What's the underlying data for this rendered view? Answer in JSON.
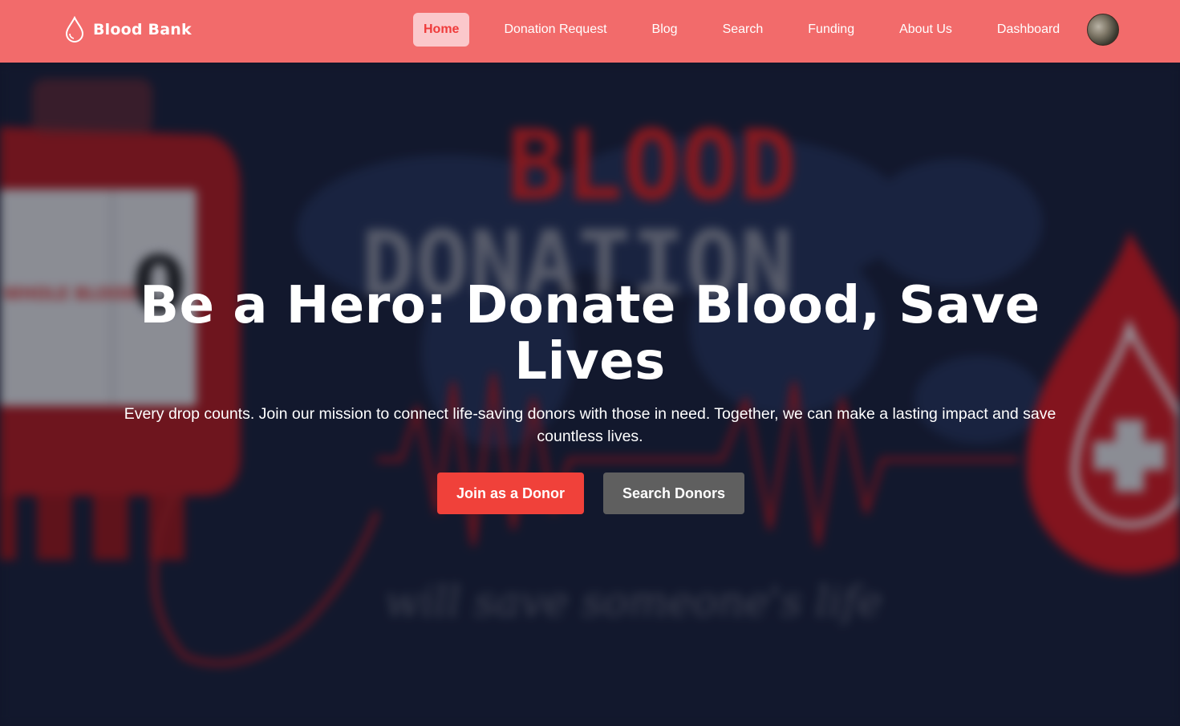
{
  "brand": {
    "name": "Blood Bank",
    "icon": "blood-drop-icon"
  },
  "nav": {
    "items": [
      {
        "label": "Home",
        "active": true
      },
      {
        "label": "Donation Request",
        "active": false
      },
      {
        "label": "Blog",
        "active": false
      },
      {
        "label": "Search",
        "active": false
      },
      {
        "label": "Funding",
        "active": false
      },
      {
        "label": "About Us",
        "active": false
      },
      {
        "label": "Dashboard",
        "active": false
      }
    ],
    "avatar": "user-avatar"
  },
  "hero": {
    "title": "Be a Hero: Donate Blood, Save Lives",
    "description": "Every drop counts. Join our mission to connect life-saving donors with those in need. Together, we can make a lasting impact and save countless lives.",
    "primary_button": "Join as a Donor",
    "secondary_button": "Search Donors",
    "background_text": {
      "line1": "BLOOD",
      "line2": "DONATION",
      "tagline": "will save someone's life",
      "bag_value": "0",
      "bag_label": "WHOLE BLOOD"
    }
  },
  "colors": {
    "navbar": "#f26b6b",
    "active_tab_bg": "#fbc8cb",
    "active_tab_text": "#ef3b3b",
    "hero_bg": "#141a2e",
    "primary_button": "#f0413a",
    "secondary_button": "#5f5f5f"
  }
}
